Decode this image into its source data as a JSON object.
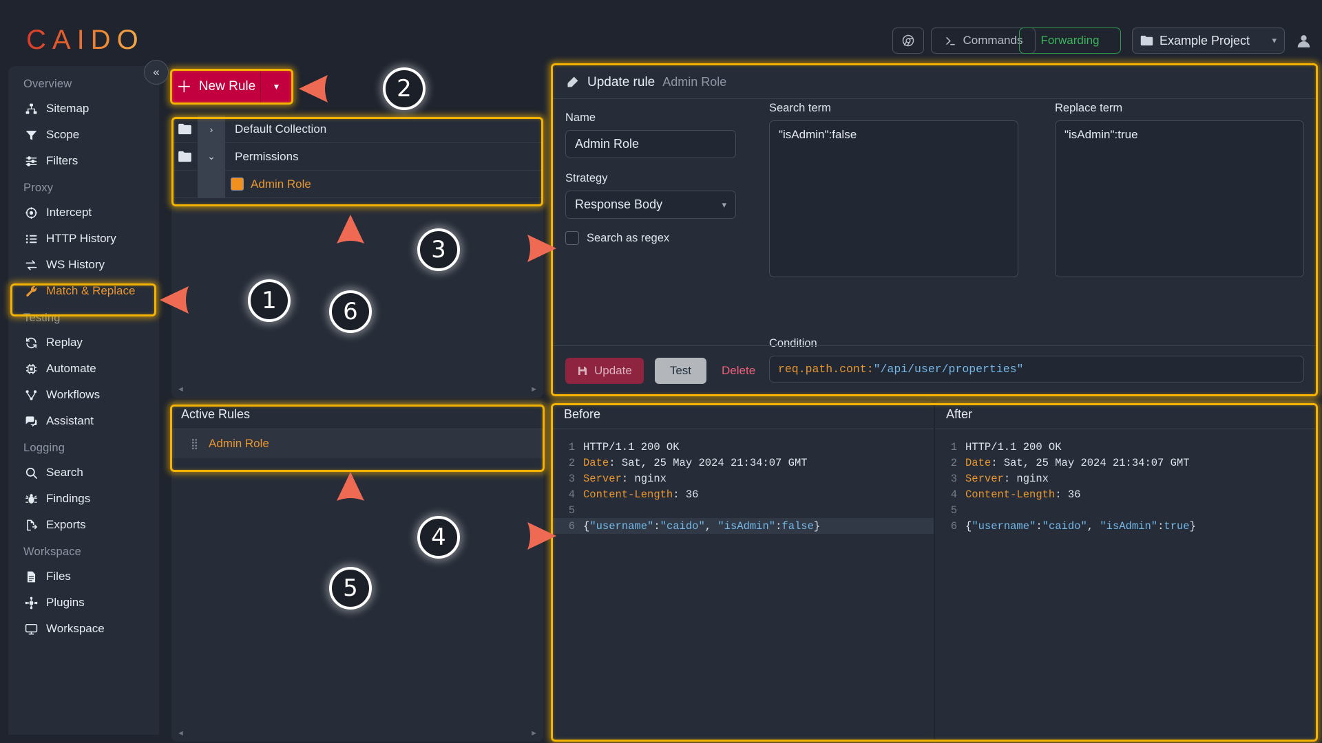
{
  "header": {
    "logo": "CAIDO",
    "browser_icon": "browser-icon",
    "commands_label": "Commands",
    "commands_icon": "terminal-prompt-icon",
    "forwarding_label": "Forwarding",
    "project_name": "Example Project",
    "project_icon": "folder-icon",
    "project_chevron": "chevron-down-icon",
    "avatar_icon": "user-avatar-icon"
  },
  "sidebar": {
    "collapse_icon": "double-chevron-left-icon",
    "groups": [
      {
        "label": "Overview",
        "items": [
          {
            "label": "Sitemap",
            "icon": "sitemap-icon",
            "active": false
          },
          {
            "label": "Scope",
            "icon": "filter-funnel-icon",
            "active": false
          },
          {
            "label": "Filters",
            "icon": "sliders-icon",
            "active": false
          }
        ]
      },
      {
        "label": "Proxy",
        "items": [
          {
            "label": "Intercept",
            "icon": "crosshair-icon",
            "active": false
          },
          {
            "label": "HTTP History",
            "icon": "list-icon",
            "active": false
          },
          {
            "label": "WS History",
            "icon": "exchange-arrows-icon",
            "active": false
          },
          {
            "label": "Match & Replace",
            "icon": "wrench-icon",
            "active": true
          }
        ]
      },
      {
        "label": "Testing",
        "items": [
          {
            "label": "Replay",
            "icon": "refresh-cycle-icon",
            "active": false
          },
          {
            "label": "Automate",
            "icon": "cpu-chip-icon",
            "active": false
          },
          {
            "label": "Workflows",
            "icon": "workflow-nodes-icon",
            "active": false
          },
          {
            "label": "Assistant",
            "icon": "chat-bubbles-icon",
            "active": false
          }
        ]
      },
      {
        "label": "Logging",
        "items": [
          {
            "label": "Search",
            "icon": "magnifier-icon",
            "active": false
          },
          {
            "label": "Findings",
            "icon": "bug-icon",
            "active": false
          },
          {
            "label": "Exports",
            "icon": "file-export-icon",
            "active": false
          }
        ]
      },
      {
        "label": "Workspace",
        "items": [
          {
            "label": "Files",
            "icon": "file-icon",
            "active": false
          },
          {
            "label": "Plugins",
            "icon": "plugin-icon",
            "active": false
          },
          {
            "label": "Workspace",
            "icon": "monitor-icon",
            "active": false
          }
        ]
      }
    ]
  },
  "rules_pane": {
    "new_rule_label": "New Rule",
    "new_rule_plus_icon": "plus-icon",
    "new_rule_caret_icon": "caret-down-icon",
    "tree": [
      {
        "label": "Default Collection",
        "type": "collection",
        "expanded": false,
        "icon": "folder-icon",
        "twisty": "chevron-right-icon"
      },
      {
        "label": "Permissions",
        "type": "collection",
        "expanded": true,
        "icon": "folder-icon",
        "twisty": "chevron-down-icon"
      },
      {
        "label": "Admin Role",
        "type": "rule",
        "swatch_color": "#f0901f"
      }
    ]
  },
  "active_rules": {
    "title": "Active Rules",
    "items": [
      {
        "label": "Admin Role",
        "grip_icon": "drag-handle-icon"
      }
    ]
  },
  "update_rule": {
    "header_icon": "edit-pencil-square-icon",
    "header_title": "Update rule",
    "header_subtitle": "Admin Role",
    "name_label": "Name",
    "name_value": "Admin Role",
    "strategy_label": "Strategy",
    "strategy_value": "Response Body",
    "strategy_chevron": "chevron-down-icon",
    "regex_label": "Search as regex",
    "regex_checked": false,
    "search_term_label": "Search term",
    "search_term_value": "\"isAdmin\":false",
    "replace_term_label": "Replace term",
    "replace_term_value": "\"isAdmin\":true",
    "condition_label": "Condition",
    "condition_key": "req.path.cont:",
    "condition_string": "\"/api/user/properties\"",
    "update_label": "Update",
    "update_icon": "save-disk-icon",
    "test_label": "Test",
    "delete_label": "Delete"
  },
  "preview": {
    "before_title": "Before",
    "after_title": "After",
    "before_lines": [
      {
        "n": "1",
        "parts": [
          {
            "t": "HTTP/1.1 200 OK",
            "c": "plain"
          }
        ]
      },
      {
        "n": "2",
        "parts": [
          {
            "t": "Date",
            "c": "hdr"
          },
          {
            "t": ": Sat, 25 May 2024 21:34:07 GMT",
            "c": "plain"
          }
        ]
      },
      {
        "n": "3",
        "parts": [
          {
            "t": "Server",
            "c": "hdr"
          },
          {
            "t": ": nginx",
            "c": "plain"
          }
        ]
      },
      {
        "n": "4",
        "parts": [
          {
            "t": "Content-Length",
            "c": "hdr"
          },
          {
            "t": ": 36",
            "c": "plain"
          }
        ]
      },
      {
        "n": "5",
        "parts": [
          {
            "t": "",
            "c": "plain"
          }
        ]
      },
      {
        "n": "6",
        "highlight": true,
        "parts": [
          {
            "t": "{",
            "c": "punct"
          },
          {
            "t": "\"username\"",
            "c": "str"
          },
          {
            "t": ":",
            "c": "punct"
          },
          {
            "t": "\"caido\"",
            "c": "str"
          },
          {
            "t": ", ",
            "c": "punct"
          },
          {
            "t": "\"isAdmin\"",
            "c": "str"
          },
          {
            "t": ":",
            "c": "punct"
          },
          {
            "t": "false",
            "c": "str"
          },
          {
            "t": "}",
            "c": "punct"
          }
        ]
      }
    ],
    "after_lines": [
      {
        "n": "1",
        "parts": [
          {
            "t": "HTTP/1.1 200 OK",
            "c": "plain"
          }
        ]
      },
      {
        "n": "2",
        "parts": [
          {
            "t": "Date",
            "c": "hdr"
          },
          {
            "t": ": Sat, 25 May 2024 21:34:07 GMT",
            "c": "plain"
          }
        ]
      },
      {
        "n": "3",
        "parts": [
          {
            "t": "Server",
            "c": "hdr"
          },
          {
            "t": ": nginx",
            "c": "plain"
          }
        ]
      },
      {
        "n": "4",
        "parts": [
          {
            "t": "Content-Length",
            "c": "hdr"
          },
          {
            "t": ": 36",
            "c": "plain"
          }
        ]
      },
      {
        "n": "5",
        "parts": [
          {
            "t": "",
            "c": "plain"
          }
        ]
      },
      {
        "n": "6",
        "parts": [
          {
            "t": "{",
            "c": "punct"
          },
          {
            "t": "\"username\"",
            "c": "str"
          },
          {
            "t": ":",
            "c": "punct"
          },
          {
            "t": "\"caido\"",
            "c": "str"
          },
          {
            "t": ", ",
            "c": "punct"
          },
          {
            "t": "\"isAdmin\"",
            "c": "str"
          },
          {
            "t": ":",
            "c": "punct"
          },
          {
            "t": "true",
            "c": "str"
          },
          {
            "t": "}",
            "c": "punct"
          }
        ]
      }
    ]
  },
  "annotations": {
    "highlight_color": "#f5b301",
    "markers": [
      {
        "id": "1",
        "label": "①"
      },
      {
        "id": "2",
        "label": "②"
      },
      {
        "id": "3",
        "label": "③"
      },
      {
        "id": "4",
        "label": "④"
      },
      {
        "id": "5",
        "label": "⑤"
      },
      {
        "id": "6",
        "label": "⑥"
      }
    ],
    "marker_1": "1",
    "marker_2": "2",
    "marker_3": "3",
    "marker_4": "4",
    "marker_5": "5",
    "marker_6": "6"
  },
  "colors": {
    "accent_orange": "#e8962f",
    "brand_red": "#c2003f",
    "forwarding_green": "#3cb45c",
    "annotation_yellow": "#f5b301"
  }
}
